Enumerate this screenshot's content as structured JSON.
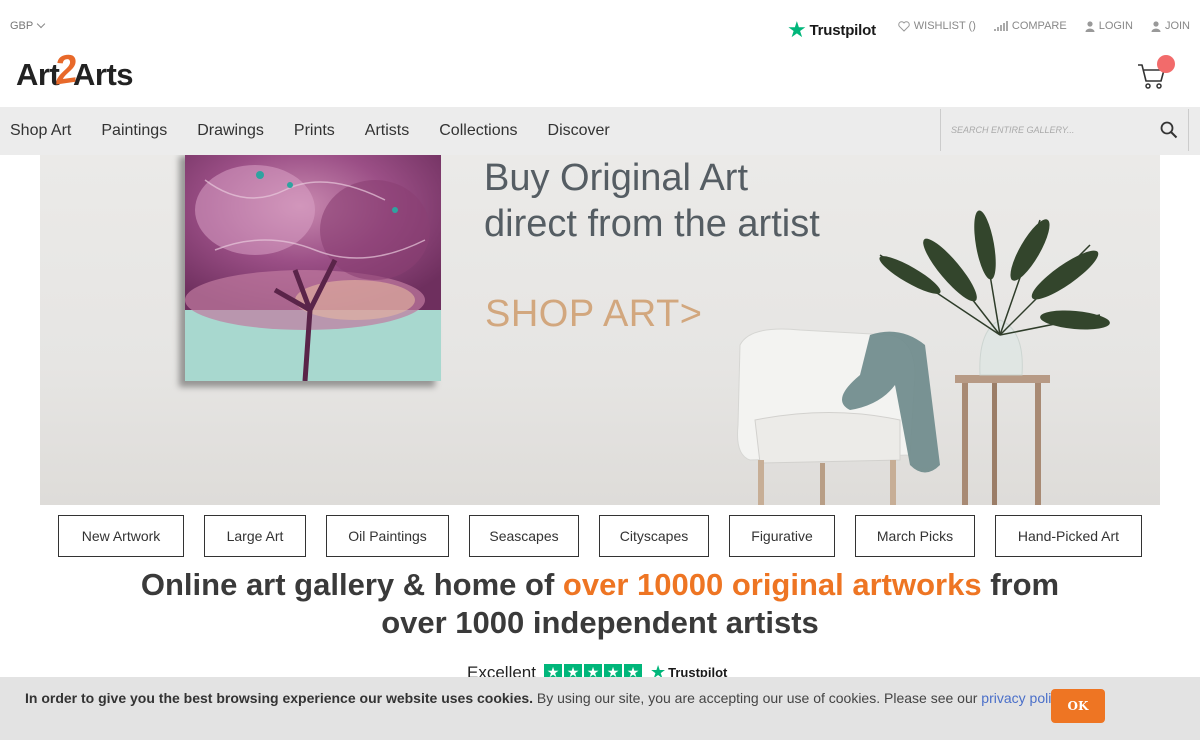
{
  "header": {
    "currency": "GBP",
    "trustpilot_label": "Trustpilot",
    "links": [
      {
        "label": "WISHLIST ()",
        "icon": "heart-icon"
      },
      {
        "label": "COMPARE",
        "icon": "bars-icon"
      },
      {
        "label": "LOGIN",
        "icon": "user-icon"
      },
      {
        "label": "JOIN",
        "icon": "user-icon"
      }
    ],
    "logo_left": "Art",
    "logo_mid": "2",
    "logo_right": "Arts"
  },
  "nav": {
    "items": [
      "Shop Art",
      "Paintings",
      "Drawings",
      "Prints",
      "Artists",
      "Collections",
      "Discover"
    ],
    "search_placeholder": "SEARCH ENTIRE GALLERY..."
  },
  "hero": {
    "title_line1": "Buy Original Art",
    "title_line2": "direct from the artist",
    "cta": "SHOP ART>"
  },
  "categories": [
    "New Artwork",
    "Large Art",
    "Oil Paintings",
    "Seascapes",
    "Cityscapes",
    "Figurative",
    "March Picks",
    "Hand-Picked Art"
  ],
  "headline": {
    "part1": "Online art gallery & home of ",
    "highlight": "over 10000 original artworks",
    "part2": " from",
    "line2": "over 1000 independent artists"
  },
  "trustpilot_widget": {
    "rating_label": "Excellent",
    "brand": "Trustpilot"
  },
  "cookie": {
    "bold": "In order to give you the best browsing experience our website uses cookies.",
    "text": " By using our site, you are accepting our use of cookies. Please see our ",
    "link": "privacy policy",
    "end": ".",
    "ok": "OK"
  },
  "colors": {
    "accent": "#ee7523",
    "trustpilot_green": "#00b67a",
    "cta": "#d2a77e",
    "cart_badge": "#f26b6b"
  }
}
